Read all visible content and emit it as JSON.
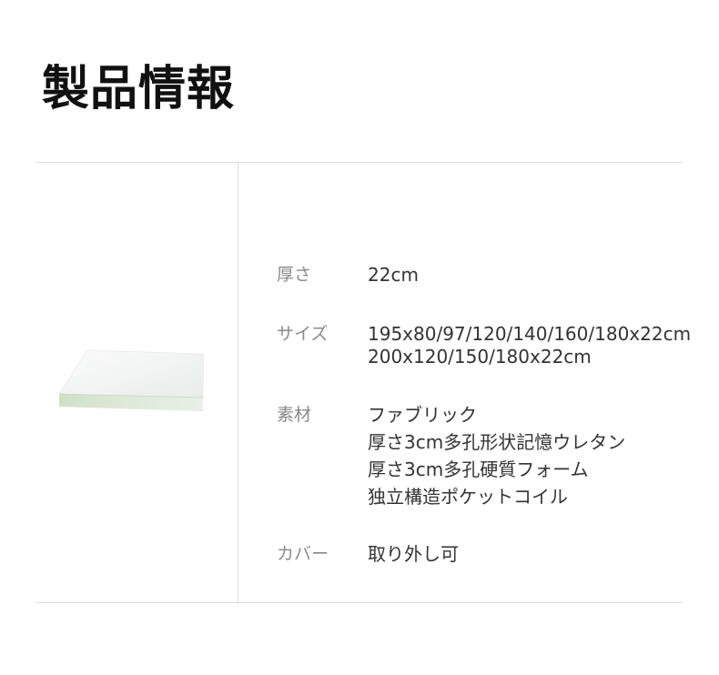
{
  "title": "製品情報",
  "specs": [
    {
      "label": "厚さ",
      "values": [
        "22cm"
      ]
    },
    {
      "label": "サイズ",
      "values": [
        "195x80/97/120/140/160/180x22cm",
        "200x120/150/180x22cm"
      ]
    },
    {
      "label": "素材",
      "values": [
        "ファブリック",
        "厚さ3cm多孔形状記憶ウレタン",
        "厚さ3cm多孔硬質フォーム",
        "独立構造ポケットコイル"
      ]
    },
    {
      "label": "カバー",
      "values": [
        "取り外し可"
      ]
    }
  ],
  "colors": {
    "rule": "#dcdcdc",
    "label": "#8a8a8a",
    "value": "#333333",
    "title": "#111111",
    "mattress_top": "#f4f6f5",
    "mattress_side": "#d7e6cf"
  },
  "image": {
    "icon": "mattress-product-image"
  }
}
